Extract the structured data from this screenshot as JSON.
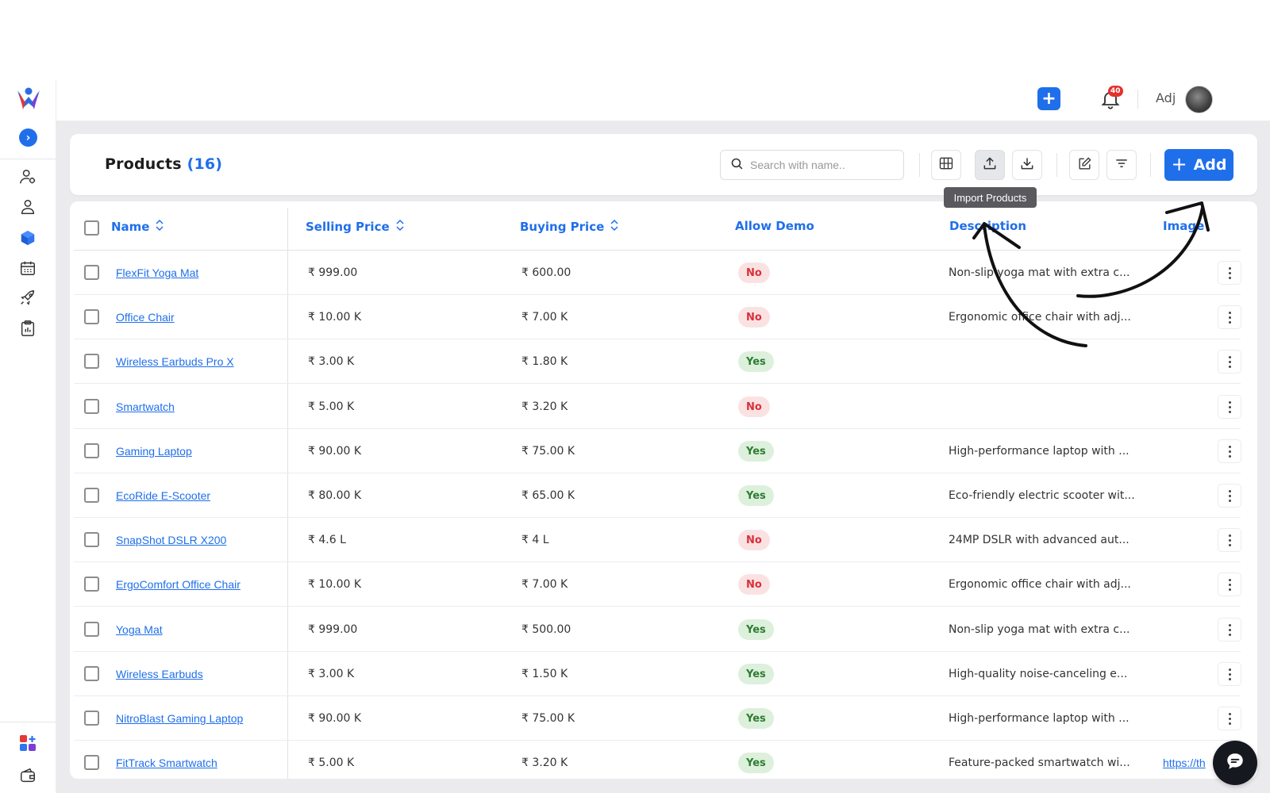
{
  "header": {
    "user_name": "Adj",
    "notification_count": "40"
  },
  "toolbar": {
    "title": "Products",
    "count": "(16)",
    "search_placeholder": "Search with name..",
    "tooltip": "Import Products",
    "add_label": "Add"
  },
  "columns": {
    "name": "Name",
    "selling_price": "Selling Price",
    "buying_price": "Buying Price",
    "allow_demo": "Allow Demo",
    "description": "Description",
    "image": "Image"
  },
  "rows": [
    {
      "name": "FlexFit Yoga Mat",
      "selling": "₹ 999.00",
      "buying": "₹ 600.00",
      "demo": "No",
      "description": "Non-slip yoga mat with extra c...",
      "image": ""
    },
    {
      "name": "Office Chair",
      "selling": "₹ 10.00 K",
      "buying": "₹ 7.00 K",
      "demo": "No",
      "description": "Ergonomic office chair with adj...",
      "image": ""
    },
    {
      "name": "Wireless Earbuds Pro X",
      "selling": "₹ 3.00 K",
      "buying": "₹ 1.80 K",
      "demo": "Yes",
      "description": "",
      "image": ""
    },
    {
      "name": "Smartwatch",
      "selling": "₹ 5.00 K",
      "buying": "₹ 3.20 K",
      "demo": "No",
      "description": "",
      "image": ""
    },
    {
      "name": "Gaming Laptop",
      "selling": "₹ 90.00 K",
      "buying": "₹ 75.00 K",
      "demo": "Yes",
      "description": "High-performance laptop with ...",
      "image": ""
    },
    {
      "name": "EcoRide E-Scooter",
      "selling": "₹ 80.00 K",
      "buying": "₹ 65.00 K",
      "demo": "Yes",
      "description": "Eco-friendly electric scooter wit...",
      "image": ""
    },
    {
      "name": "SnapShot DSLR X200",
      "selling": "₹ 4.6 L",
      "buying": "₹ 4 L",
      "demo": "No",
      "description": "24MP DSLR with advanced aut...",
      "image": ""
    },
    {
      "name": "ErgoComfort Office Chair",
      "selling": "₹ 10.00 K",
      "buying": "₹ 7.00 K",
      "demo": "No",
      "description": "Ergonomic office chair with adj...",
      "image": ""
    },
    {
      "name": "Yoga Mat",
      "selling": "₹ 999.00",
      "buying": "₹ 500.00",
      "demo": "Yes",
      "description": "Non-slip yoga mat with extra c...",
      "image": ""
    },
    {
      "name": "Wireless Earbuds",
      "selling": "₹ 3.00 K",
      "buying": "₹ 1.50 K",
      "demo": "Yes",
      "description": "High-quality noise-canceling e...",
      "image": ""
    },
    {
      "name": "NitroBlast Gaming Laptop",
      "selling": "₹ 90.00 K",
      "buying": "₹ 75.00 K",
      "demo": "Yes",
      "description": "High-performance laptop with ...",
      "image": ""
    },
    {
      "name": "FitTrack Smartwatch",
      "selling": "₹ 5.00 K",
      "buying": "₹ 3.20 K",
      "demo": "Yes",
      "description": "Feature-packed smartwatch wi...",
      "image": "https://th"
    }
  ],
  "icons": {
    "sidebar": [
      "user-settings-icon",
      "user-icon",
      "box-icon",
      "calendar-icon",
      "rocket-icon",
      "report-icon",
      "apps-icon",
      "wallet-icon"
    ],
    "toolbar": [
      "columns-icon",
      "upload-icon",
      "download-icon",
      "edit-icon",
      "filter-icon"
    ]
  },
  "colors": {
    "accent": "#1f6feb",
    "no_badge_bg": "#fbe2e2",
    "no_badge_text": "#d9303a",
    "yes_badge_bg": "#dcf0dc",
    "yes_badge_text": "#2e7d32"
  }
}
